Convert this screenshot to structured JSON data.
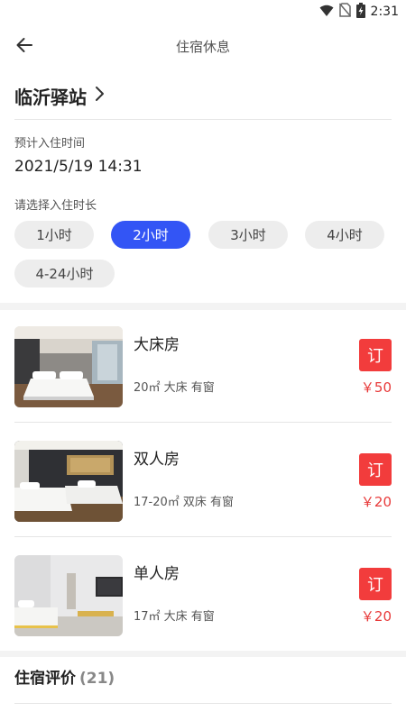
{
  "status_bar": {
    "time": "2:31",
    "icons": [
      "wifi-icon",
      "no-sim-icon",
      "battery-charging-icon"
    ]
  },
  "app_bar": {
    "title": "住宿休息",
    "back_icon": "arrow-left-icon"
  },
  "station": {
    "name": "临沂驿站",
    "chevron_icon": "chevron-right-icon"
  },
  "checkin": {
    "label": "预计入住时间",
    "value": "2021/5/19 14:31"
  },
  "duration": {
    "label": "请选择入住时长",
    "options": [
      "1小时",
      "2小时",
      "3小时",
      "4小时",
      "4-24小时"
    ],
    "selected": "2小时"
  },
  "rooms": [
    {
      "name": "大床房",
      "desc": "20㎡ 大床 有窗",
      "price": "￥50",
      "book_label": "订"
    },
    {
      "name": "双人房",
      "desc": "17-20㎡ 双床 有窗",
      "price": "￥20",
      "book_label": "订"
    },
    {
      "name": "单人房",
      "desc": "17㎡ 大床 有窗",
      "price": "￥20",
      "book_label": "订"
    }
  ],
  "reviews": {
    "label": "住宿评价",
    "count": "(21)"
  },
  "colors": {
    "accent": "#3355f5",
    "book_red": "#f23c3c",
    "price_red": "#e83a3a"
  }
}
